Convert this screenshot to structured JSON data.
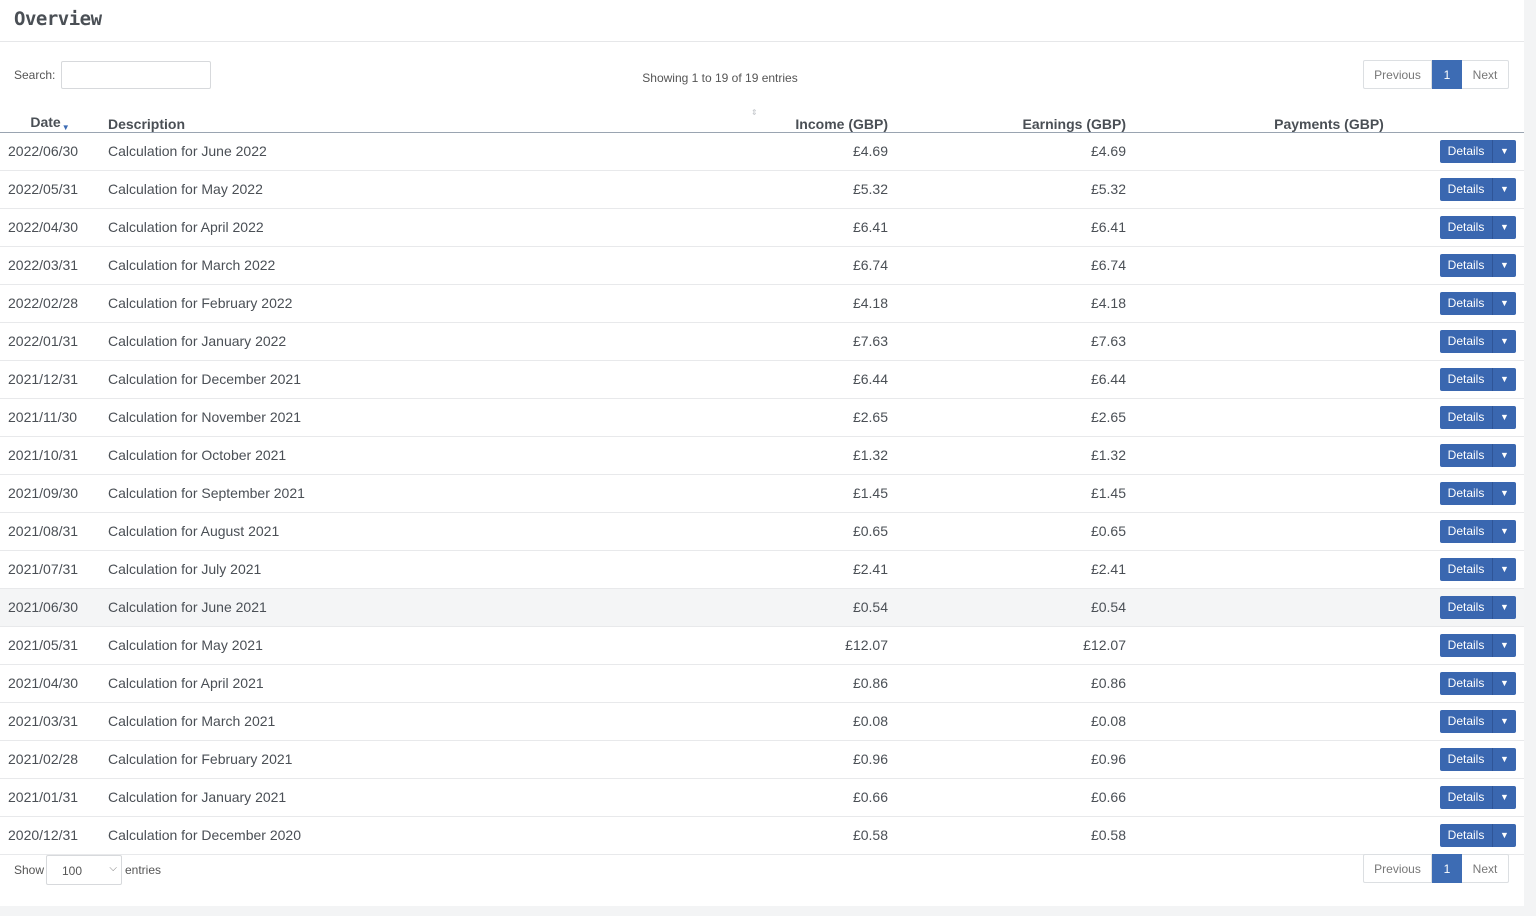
{
  "panel": {
    "title": "Overview"
  },
  "search": {
    "label": "Search:",
    "value": ""
  },
  "info": "Showing 1 to 19 of 19 entries",
  "pager": {
    "previous": "Previous",
    "current": "1",
    "next": "Next"
  },
  "columns": {
    "date": "Date",
    "description": "Description",
    "income": "Income (GBP)",
    "earnings": "Earnings (GBP)",
    "payments": "Payments (GBP)"
  },
  "rows": [
    {
      "date": "2022/06/30",
      "description": "Calculation for June 2022",
      "income": "£4.69",
      "earnings": "£4.69"
    },
    {
      "date": "2022/05/31",
      "description": "Calculation for May 2022",
      "income": "£5.32",
      "earnings": "£5.32"
    },
    {
      "date": "2022/04/30",
      "description": "Calculation for April 2022",
      "income": "£6.41",
      "earnings": "£6.41"
    },
    {
      "date": "2022/03/31",
      "description": "Calculation for March 2022",
      "income": "£6.74",
      "earnings": "£6.74"
    },
    {
      "date": "2022/02/28",
      "description": "Calculation for February 2022",
      "income": "£4.18",
      "earnings": "£4.18"
    },
    {
      "date": "2022/01/31",
      "description": "Calculation for January 2022",
      "income": "£7.63",
      "earnings": "£7.63"
    },
    {
      "date": "2021/12/31",
      "description": "Calculation for December 2021",
      "income": "£6.44",
      "earnings": "£6.44"
    },
    {
      "date": "2021/11/30",
      "description": "Calculation for November 2021",
      "income": "£2.65",
      "earnings": "£2.65"
    },
    {
      "date": "2021/10/31",
      "description": "Calculation for October 2021",
      "income": "£1.32",
      "earnings": "£1.32"
    },
    {
      "date": "2021/09/30",
      "description": "Calculation for September 2021",
      "income": "£1.45",
      "earnings": "£1.45"
    },
    {
      "date": "2021/08/31",
      "description": "Calculation for August 2021",
      "income": "£0.65",
      "earnings": "£0.65"
    },
    {
      "date": "2021/07/31",
      "description": "Calculation for July 2021",
      "income": "£2.41",
      "earnings": "£2.41"
    },
    {
      "date": "2021/06/30",
      "description": "Calculation for June 2021",
      "income": "£0.54",
      "earnings": "£0.54"
    },
    {
      "date": "2021/05/31",
      "description": "Calculation for May 2021",
      "income": "£12.07",
      "earnings": "£12.07"
    },
    {
      "date": "2021/04/30",
      "description": "Calculation for April 2021",
      "income": "£0.86",
      "earnings": "£0.86"
    },
    {
      "date": "2021/03/31",
      "description": "Calculation for March 2021",
      "income": "£0.08",
      "earnings": "£0.08"
    },
    {
      "date": "2021/02/28",
      "description": "Calculation for February 2021",
      "income": "£0.96",
      "earnings": "£0.96"
    },
    {
      "date": "2021/01/31",
      "description": "Calculation for January 2021",
      "income": "£0.66",
      "earnings": "£0.66"
    },
    {
      "date": "2020/12/31",
      "description": "Calculation for December 2020",
      "income": "£0.58",
      "earnings": "£0.58"
    }
  ],
  "highlighted_row": 12,
  "details_label": "Details",
  "length": {
    "label_before": "Show",
    "value": "100",
    "label_after": "entries"
  },
  "colors": {
    "accent": "#3d6cb4",
    "button": "#3a67b0",
    "text": "#4a4f55"
  },
  "icons": {
    "sort": "sort-desc-caret-icon",
    "dropdown": "caret-down-icon",
    "select": "chevron-down-icon"
  }
}
